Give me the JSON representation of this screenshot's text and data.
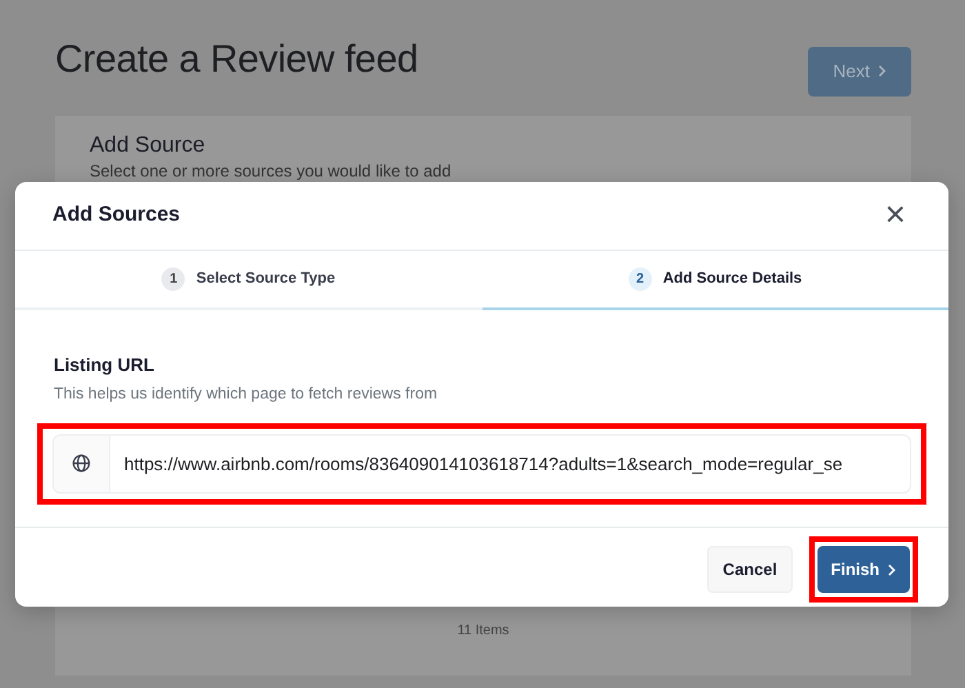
{
  "page": {
    "title": "Create a Review feed",
    "next_button": "Next",
    "card_title": "Add Source",
    "card_subtitle": "Select one or more sources you would like to add",
    "item_count": "11 Items"
  },
  "modal": {
    "title": "Add Sources",
    "close": "×",
    "steps": [
      {
        "number": "1",
        "label": "Select Source Type",
        "selected": false
      },
      {
        "number": "2",
        "label": "Add Source Details",
        "selected": true
      }
    ],
    "field_label": "Listing URL",
    "field_help": "This helps us identify which page to fetch reviews from",
    "url_field": {
      "value": "https://www.airbnb.com/rooms/836409014103618714?adults=1&search_mode=regular_se",
      "highlighted": true
    },
    "buttons": [
      {
        "kind": "secondary",
        "label": "Cancel",
        "highlighted": false
      },
      {
        "kind": "primary",
        "label": "Finish",
        "highlighted": true
      }
    ]
  }
}
